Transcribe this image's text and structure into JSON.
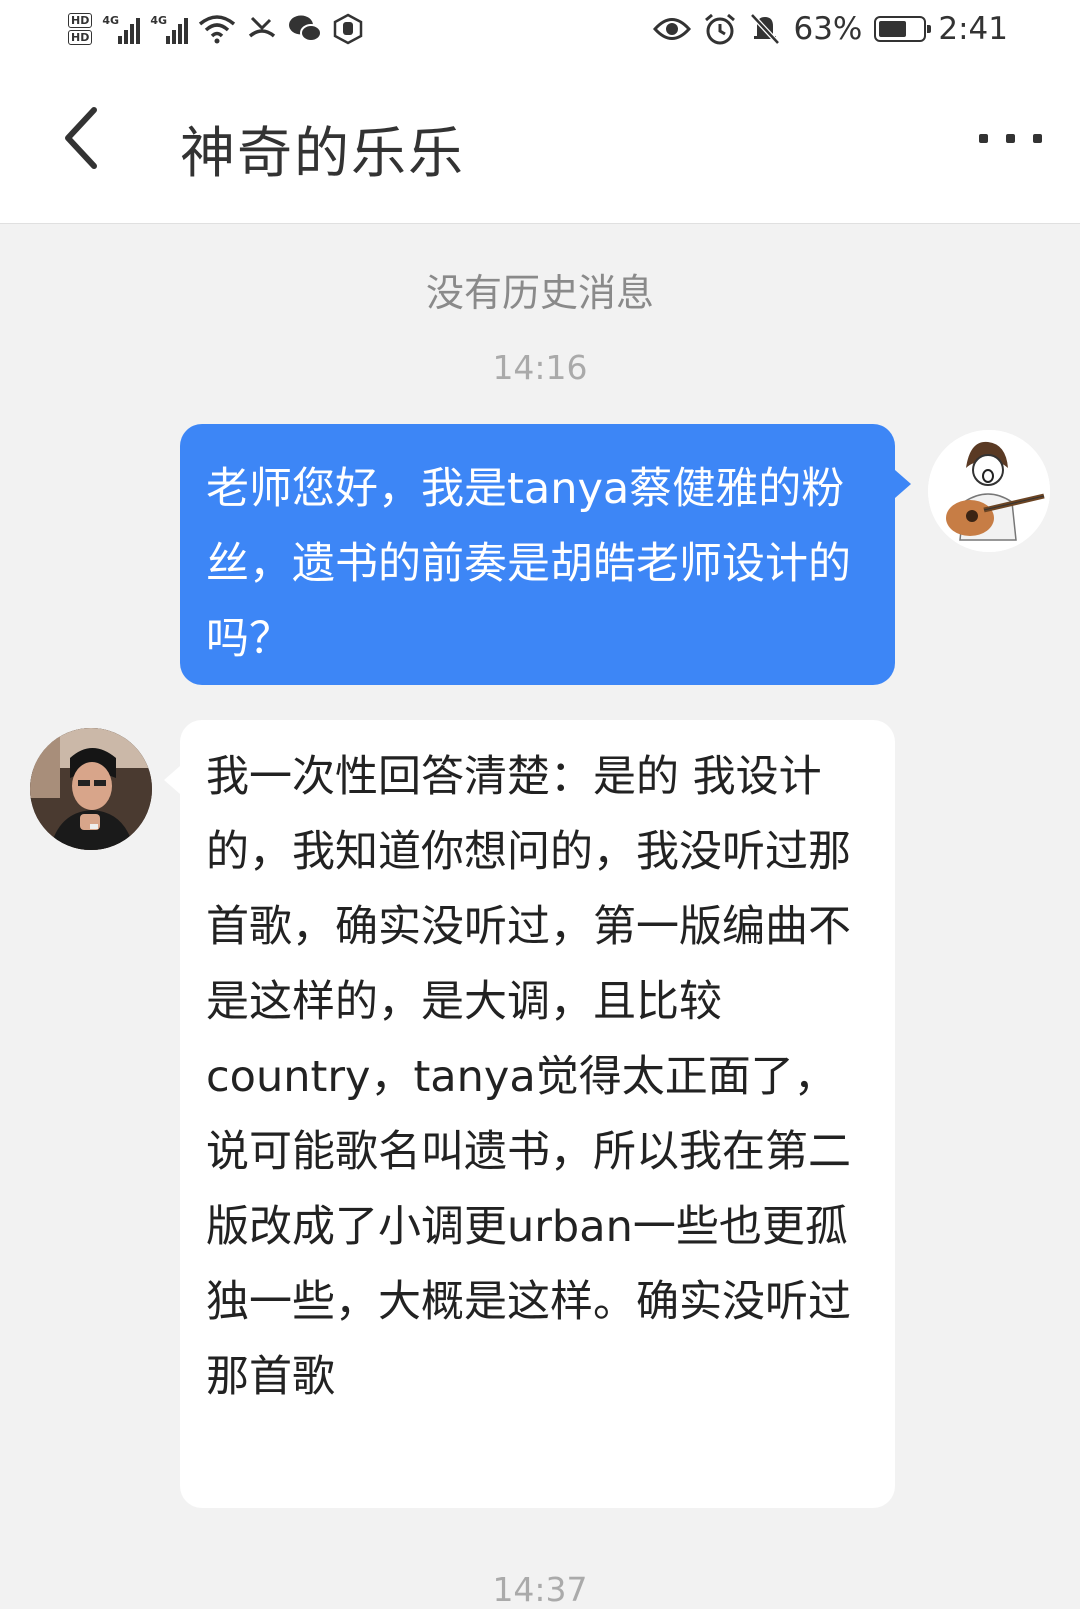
{
  "status_bar": {
    "hd1": "HD",
    "hd2": "HD",
    "net1": "4G",
    "net2": "4G",
    "battery_percent": "63%",
    "battery_level": 0.63,
    "time": "2:41",
    "icons": [
      "signal-icon",
      "signal-icon",
      "wifi-icon",
      "missed-call-icon",
      "wechat-icon",
      "hand-icon",
      "eye-icon",
      "alarm-icon",
      "bell-off-icon",
      "battery-icon"
    ]
  },
  "header": {
    "title": "神奇的乐乐",
    "back_icon": "chevron-left-icon",
    "more_icon": "more-dots-icon"
  },
  "chat": {
    "no_history": "没有历史消息",
    "timestamp_1": "14:16",
    "timestamp_2": "14:37",
    "sent_message": "老师您好，我是tanya蔡健雅的粉丝，遗书的前奏是胡皓老师设计的吗？",
    "received_message": "我一次性回答清楚：是的 我设计的，我知道你想问的，我没听过那首歌，确实没听过，第一版编曲不是这样的，是大调，且比较country，tanya觉得太正面了，说可能歌名叫遗书，所以我在第二版改成了小调更urban一些也更孤独一些，大概是这样。确实没听过那首歌"
  },
  "colors": {
    "sent_bubble": "#3d86f6",
    "received_bubble": "#ffffff",
    "background": "#f2f2f2"
  }
}
